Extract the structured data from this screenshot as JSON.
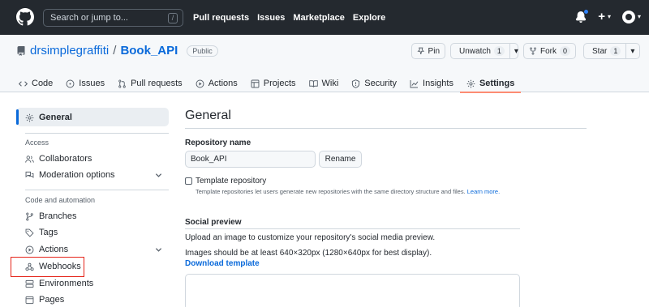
{
  "topbar": {
    "search_placeholder": "Search or jump to...",
    "search_shortcut": "/",
    "nav": [
      "Pull requests",
      "Issues",
      "Marketplace",
      "Explore"
    ],
    "plus_label": "+",
    "plus_caret": "▾",
    "avatar_caret": "▾"
  },
  "repo": {
    "owner": "drsimplegraffiti",
    "separator": "/",
    "name": "Book_API",
    "visibility": "Public",
    "pin_label": "Pin",
    "watch_label": "Unwatch",
    "watch_count": "1",
    "fork_label": "Fork",
    "fork_count": "0",
    "star_label": "Star",
    "star_count": "1",
    "caret": "▾"
  },
  "tabs": [
    {
      "label": "Code",
      "icon": "code-icon"
    },
    {
      "label": "Issues",
      "icon": "issue-icon"
    },
    {
      "label": "Pull requests",
      "icon": "pull-request-icon"
    },
    {
      "label": "Actions",
      "icon": "play-icon"
    },
    {
      "label": "Projects",
      "icon": "table-icon"
    },
    {
      "label": "Wiki",
      "icon": "book-icon"
    },
    {
      "label": "Security",
      "icon": "shield-icon"
    },
    {
      "label": "Insights",
      "icon": "graph-icon"
    },
    {
      "label": "Settings",
      "icon": "gear-icon",
      "active": true
    }
  ],
  "sidebar": {
    "general": "General",
    "access_heading": "Access",
    "collaborators": "Collaborators",
    "moderation": "Moderation options",
    "code_heading": "Code and automation",
    "branches": "Branches",
    "tags": "Tags",
    "actions": "Actions",
    "webhooks": "Webhooks",
    "environments": "Environments",
    "pages": "Pages"
  },
  "main": {
    "title": "General",
    "repo_name_label": "Repository name",
    "repo_name_value": "Book_API",
    "rename_button": "Rename",
    "template_label": "Template repository",
    "template_desc": "Template repositories let users generate new repositories with the same directory structure and files.",
    "template_link": "Learn more.",
    "social_title": "Social preview",
    "social_desc": "Upload an image to customize your repository's social media preview.",
    "image_hint": "Images should be at least 640×320px (1280×640px for best display).",
    "download_template": "Download template"
  },
  "colors": {
    "header_bg": "#24292f",
    "link": "#0969da",
    "tab_underline": "#fd8c73",
    "annotation": "#e5241a"
  }
}
